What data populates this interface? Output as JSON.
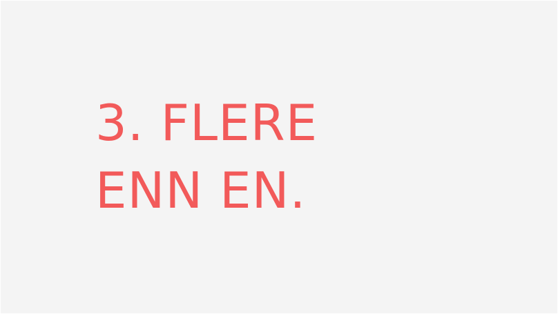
{
  "slide": {
    "heading_lines": [
      "3. FLERE",
      "ENN EN."
    ],
    "text_color": "#f25a5a",
    "background_color": "#f4f4f4"
  }
}
